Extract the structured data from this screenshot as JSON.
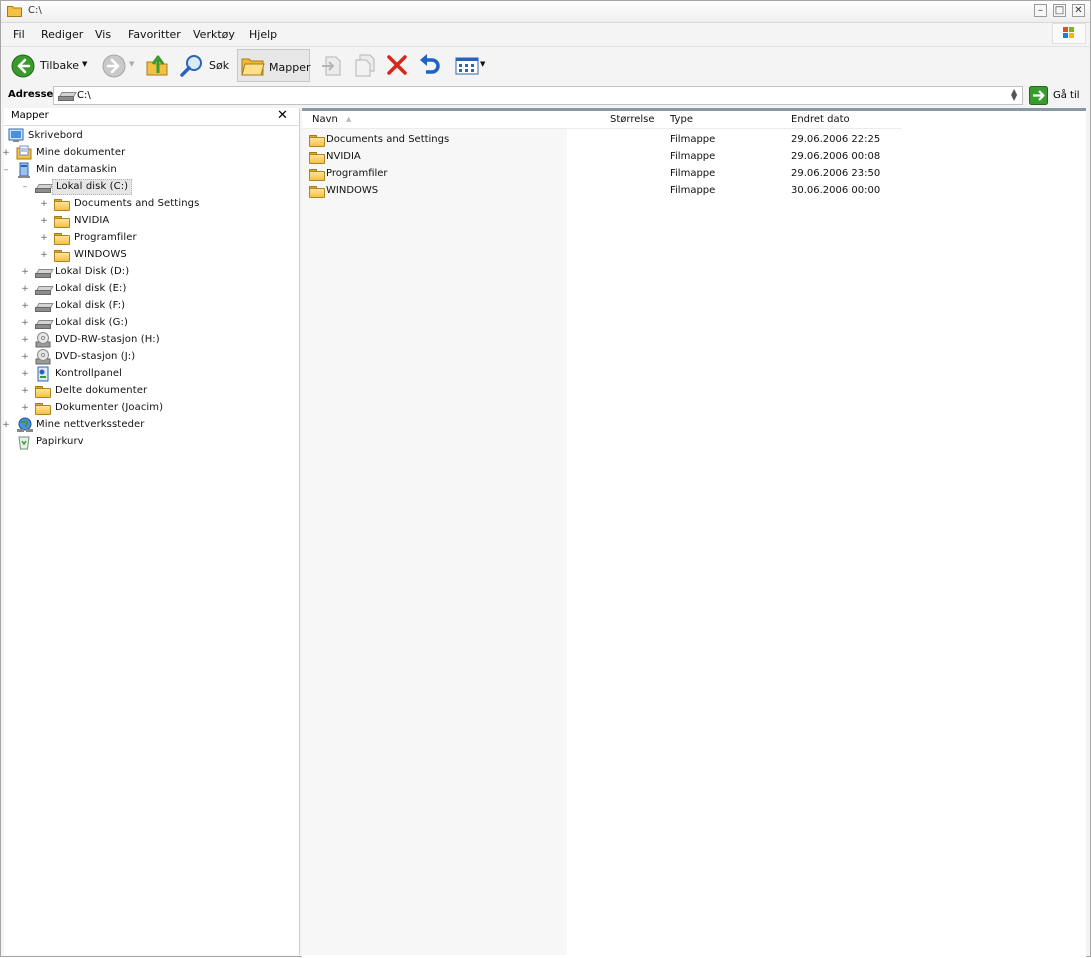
{
  "window": {
    "title": "C:\\",
    "buttons": [
      "minimize",
      "maximize",
      "close"
    ]
  },
  "menu": [
    "Fil",
    "Rediger",
    "Vis",
    "Favoritter",
    "Verktøy",
    "Hjelp"
  ],
  "toolbar": {
    "back_label": "Tilbake",
    "search_label": "Søk",
    "folders_label": "Mapper"
  },
  "address": {
    "label": "Adresse",
    "value": "C:\\",
    "go_label": "Gå til"
  },
  "folder_pane": {
    "title": "Mapper",
    "tree": [
      {
        "label": "Skrivebord",
        "icon": "desktop-icon",
        "level": 0,
        "expander": ""
      },
      {
        "label": "Mine dokumenter",
        "icon": "my-documents-icon",
        "level": 1,
        "expander": "+"
      },
      {
        "label": "Min datamaskin",
        "icon": "computer-icon",
        "level": 1,
        "expander": "–"
      },
      {
        "label": "Lokal disk (C:)",
        "icon": "drive-icon",
        "level": 2,
        "expander": "–",
        "selected": true
      },
      {
        "label": "Documents and Settings",
        "icon": "folder-icon",
        "level": 3,
        "expander": "+"
      },
      {
        "label": "NVIDIA",
        "icon": "folder-icon",
        "level": 3,
        "expander": "+"
      },
      {
        "label": "Programfiler",
        "icon": "folder-icon",
        "level": 3,
        "expander": "+"
      },
      {
        "label": "WINDOWS",
        "icon": "folder-icon",
        "level": 3,
        "expander": "+"
      },
      {
        "label": "Lokal Disk (D:)",
        "icon": "drive-icon",
        "level": 2,
        "expander": "+"
      },
      {
        "label": "Lokal disk (E:)",
        "icon": "drive-icon",
        "level": 2,
        "expander": "+"
      },
      {
        "label": "Lokal disk (F:)",
        "icon": "drive-icon",
        "level": 2,
        "expander": "+"
      },
      {
        "label": "Lokal disk (G:)",
        "icon": "drive-icon",
        "level": 2,
        "expander": "+"
      },
      {
        "label": "DVD-RW-stasjon (H:)",
        "icon": "dvd-icon",
        "level": 2,
        "expander": "+"
      },
      {
        "label": "DVD-stasjon (J:)",
        "icon": "dvd-icon",
        "level": 2,
        "expander": "+"
      },
      {
        "label": "Kontrollpanel",
        "icon": "control-panel-icon",
        "level": 2,
        "expander": "+"
      },
      {
        "label": "Delte dokumenter",
        "icon": "folder-icon",
        "level": 2,
        "expander": "+"
      },
      {
        "label": "Dokumenter (Joacim)",
        "icon": "folder-icon",
        "level": 2,
        "expander": "+"
      },
      {
        "label": "Mine nettverkssteder",
        "icon": "network-icon",
        "level": 1,
        "expander": "+"
      },
      {
        "label": "Papirkurv",
        "icon": "recycle-bin-icon",
        "level": 1,
        "expander": ""
      }
    ]
  },
  "list": {
    "columns": [
      "Navn",
      "Størrelse",
      "Type",
      "Endret dato"
    ],
    "rows": [
      {
        "name": "Documents and Settings",
        "size": "",
        "type": "Filmappe",
        "modified": "29.06.2006 22:25"
      },
      {
        "name": "NVIDIA",
        "size": "",
        "type": "Filmappe",
        "modified": "29.06.2006 00:08"
      },
      {
        "name": "Programfiler",
        "size": "",
        "type": "Filmappe",
        "modified": "29.06.2006 23:50"
      },
      {
        "name": "WINDOWS",
        "size": "",
        "type": "Filmappe",
        "modified": "30.06.2006 00:00"
      }
    ]
  },
  "colors": {
    "back_green": "#3a9a2e",
    "delete_red": "#d9261c",
    "undo_blue": "#1e63c4",
    "selection": "#e6e6e6",
    "pane_border": "#8a97a4"
  }
}
